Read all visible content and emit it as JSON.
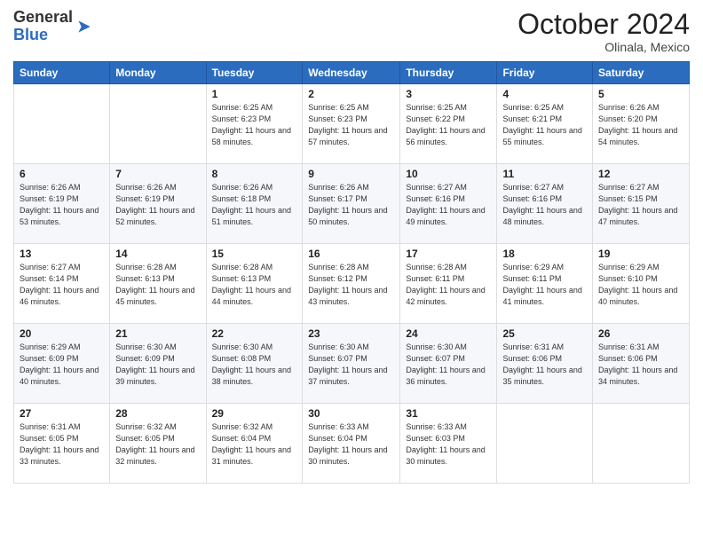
{
  "logo": {
    "general": "General",
    "blue": "Blue"
  },
  "header": {
    "month": "October 2024",
    "location": "Olinala, Mexico"
  },
  "weekdays": [
    "Sunday",
    "Monday",
    "Tuesday",
    "Wednesday",
    "Thursday",
    "Friday",
    "Saturday"
  ],
  "weeks": [
    [
      {
        "day": "",
        "info": ""
      },
      {
        "day": "",
        "info": ""
      },
      {
        "day": "1",
        "info": "Sunrise: 6:25 AM\nSunset: 6:23 PM\nDaylight: 11 hours and 58 minutes."
      },
      {
        "day": "2",
        "info": "Sunrise: 6:25 AM\nSunset: 6:23 PM\nDaylight: 11 hours and 57 minutes."
      },
      {
        "day": "3",
        "info": "Sunrise: 6:25 AM\nSunset: 6:22 PM\nDaylight: 11 hours and 56 minutes."
      },
      {
        "day": "4",
        "info": "Sunrise: 6:25 AM\nSunset: 6:21 PM\nDaylight: 11 hours and 55 minutes."
      },
      {
        "day": "5",
        "info": "Sunrise: 6:26 AM\nSunset: 6:20 PM\nDaylight: 11 hours and 54 minutes."
      }
    ],
    [
      {
        "day": "6",
        "info": "Sunrise: 6:26 AM\nSunset: 6:19 PM\nDaylight: 11 hours and 53 minutes."
      },
      {
        "day": "7",
        "info": "Sunrise: 6:26 AM\nSunset: 6:19 PM\nDaylight: 11 hours and 52 minutes."
      },
      {
        "day": "8",
        "info": "Sunrise: 6:26 AM\nSunset: 6:18 PM\nDaylight: 11 hours and 51 minutes."
      },
      {
        "day": "9",
        "info": "Sunrise: 6:26 AM\nSunset: 6:17 PM\nDaylight: 11 hours and 50 minutes."
      },
      {
        "day": "10",
        "info": "Sunrise: 6:27 AM\nSunset: 6:16 PM\nDaylight: 11 hours and 49 minutes."
      },
      {
        "day": "11",
        "info": "Sunrise: 6:27 AM\nSunset: 6:16 PM\nDaylight: 11 hours and 48 minutes."
      },
      {
        "day": "12",
        "info": "Sunrise: 6:27 AM\nSunset: 6:15 PM\nDaylight: 11 hours and 47 minutes."
      }
    ],
    [
      {
        "day": "13",
        "info": "Sunrise: 6:27 AM\nSunset: 6:14 PM\nDaylight: 11 hours and 46 minutes."
      },
      {
        "day": "14",
        "info": "Sunrise: 6:28 AM\nSunset: 6:13 PM\nDaylight: 11 hours and 45 minutes."
      },
      {
        "day": "15",
        "info": "Sunrise: 6:28 AM\nSunset: 6:13 PM\nDaylight: 11 hours and 44 minutes."
      },
      {
        "day": "16",
        "info": "Sunrise: 6:28 AM\nSunset: 6:12 PM\nDaylight: 11 hours and 43 minutes."
      },
      {
        "day": "17",
        "info": "Sunrise: 6:28 AM\nSunset: 6:11 PM\nDaylight: 11 hours and 42 minutes."
      },
      {
        "day": "18",
        "info": "Sunrise: 6:29 AM\nSunset: 6:11 PM\nDaylight: 11 hours and 41 minutes."
      },
      {
        "day": "19",
        "info": "Sunrise: 6:29 AM\nSunset: 6:10 PM\nDaylight: 11 hours and 40 minutes."
      }
    ],
    [
      {
        "day": "20",
        "info": "Sunrise: 6:29 AM\nSunset: 6:09 PM\nDaylight: 11 hours and 40 minutes."
      },
      {
        "day": "21",
        "info": "Sunrise: 6:30 AM\nSunset: 6:09 PM\nDaylight: 11 hours and 39 minutes."
      },
      {
        "day": "22",
        "info": "Sunrise: 6:30 AM\nSunset: 6:08 PM\nDaylight: 11 hours and 38 minutes."
      },
      {
        "day": "23",
        "info": "Sunrise: 6:30 AM\nSunset: 6:07 PM\nDaylight: 11 hours and 37 minutes."
      },
      {
        "day": "24",
        "info": "Sunrise: 6:30 AM\nSunset: 6:07 PM\nDaylight: 11 hours and 36 minutes."
      },
      {
        "day": "25",
        "info": "Sunrise: 6:31 AM\nSunset: 6:06 PM\nDaylight: 11 hours and 35 minutes."
      },
      {
        "day": "26",
        "info": "Sunrise: 6:31 AM\nSunset: 6:06 PM\nDaylight: 11 hours and 34 minutes."
      }
    ],
    [
      {
        "day": "27",
        "info": "Sunrise: 6:31 AM\nSunset: 6:05 PM\nDaylight: 11 hours and 33 minutes."
      },
      {
        "day": "28",
        "info": "Sunrise: 6:32 AM\nSunset: 6:05 PM\nDaylight: 11 hours and 32 minutes."
      },
      {
        "day": "29",
        "info": "Sunrise: 6:32 AM\nSunset: 6:04 PM\nDaylight: 11 hours and 31 minutes."
      },
      {
        "day": "30",
        "info": "Sunrise: 6:33 AM\nSunset: 6:04 PM\nDaylight: 11 hours and 30 minutes."
      },
      {
        "day": "31",
        "info": "Sunrise: 6:33 AM\nSunset: 6:03 PM\nDaylight: 11 hours and 30 minutes."
      },
      {
        "day": "",
        "info": ""
      },
      {
        "day": "",
        "info": ""
      }
    ]
  ]
}
